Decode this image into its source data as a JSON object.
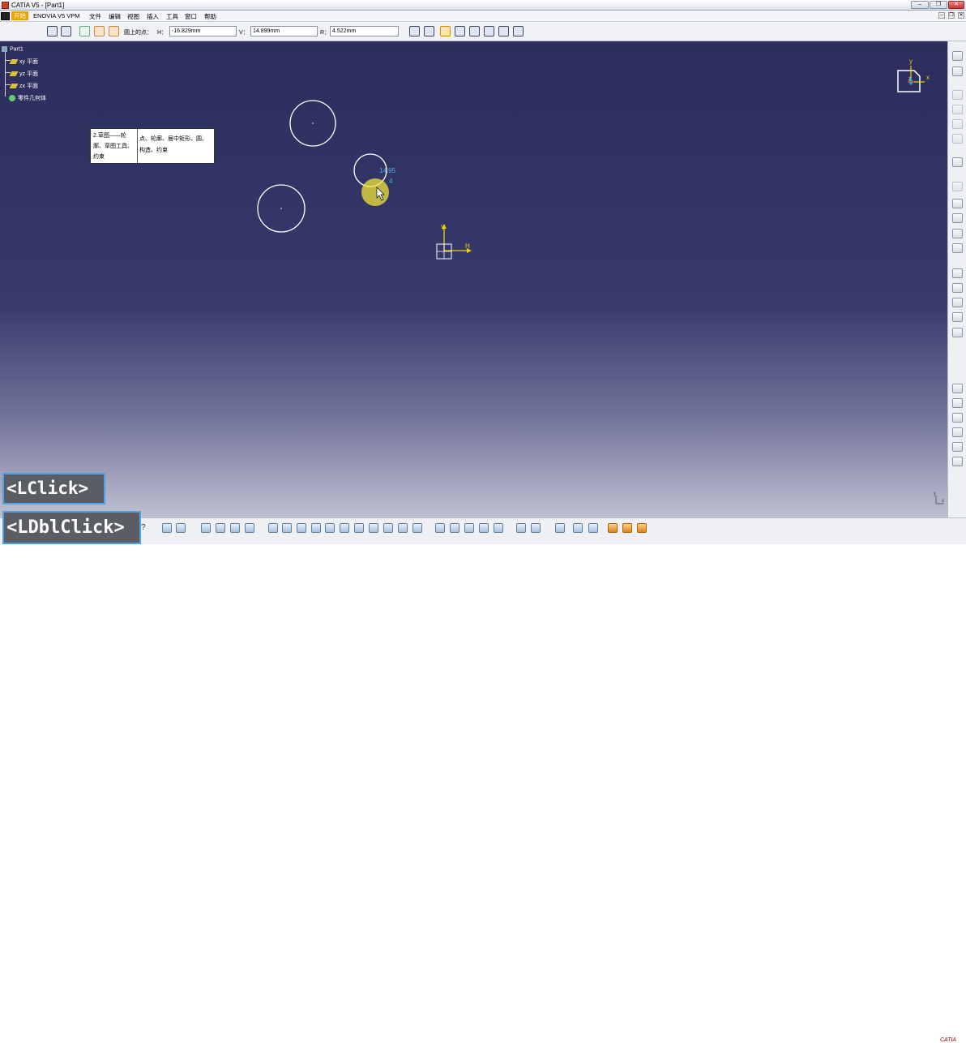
{
  "window": {
    "title": "CATIA V5 - [Part1]",
    "minimize": "–",
    "restore": "❐",
    "close": "✕",
    "doc_minimize": "–",
    "doc_restore": "❐",
    "doc_close": "✕"
  },
  "menu": {
    "start": "开始",
    "items": [
      "ENOVIA V5 VPM",
      "文件",
      "编辑",
      "视图",
      "插入",
      "工具",
      "窗口",
      "帮助"
    ]
  },
  "sketch_tools": {
    "label": "圆上的点：",
    "h_label": "H：",
    "h_value": "-16.829mm",
    "v_label": "V：",
    "v_value": "14.899mm",
    "r_label": "R：",
    "r_value": "4.522mm"
  },
  "tree": {
    "root": "Part1",
    "items": [
      "xy 平面",
      "yz 平面",
      "zx 平面",
      "零件几何体"
    ]
  },
  "callout": {
    "left": "2.草图——轮廓、草图工具、约束",
    "right": "点、轮廓、居中矩形、圆、构造、约束"
  },
  "canvas": {
    "dim_readout_1": "14.95",
    "dim_readout_2": "4",
    "axis_v": "V",
    "axis_h": "H",
    "compass_x": "x",
    "compass_y": "y",
    "compass_z": "z",
    "mini_axis_y": "y",
    "mini_axis_x": "x"
  },
  "badges": {
    "action1": "<LClick>",
    "action2": "<LDblClick>"
  },
  "logo": "CATIA",
  "colors": {
    "circle": "#ffffff",
    "axis": "#f0d000",
    "dimension": "#4fb0e0",
    "cursor_highlight": "#f2e33a",
    "badge_border": "#4aa3e6"
  }
}
